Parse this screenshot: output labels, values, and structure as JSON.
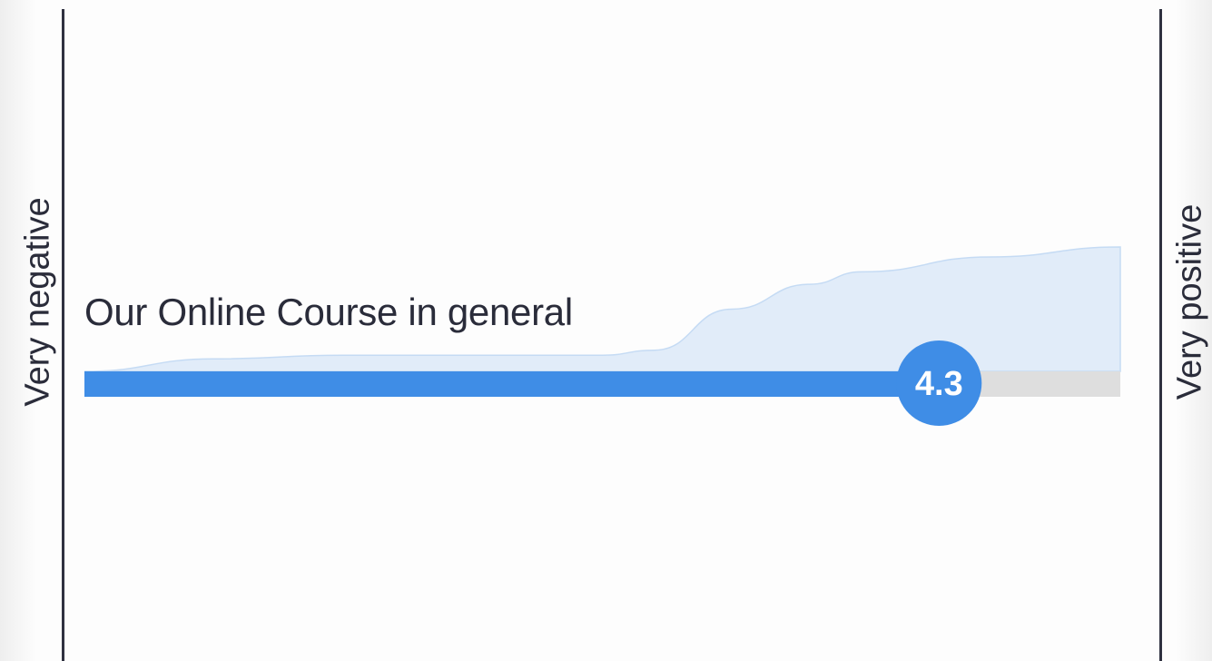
{
  "chart_data": {
    "type": "area",
    "title": "",
    "item_label": "Our Online Course in general",
    "scale_min_label": "Very negative",
    "scale_max_label": "Very positive",
    "score": 4.3,
    "score_label": "4.3",
    "scale_range": [
      1,
      5
    ],
    "distribution": {
      "x": [
        1.0,
        1.5,
        2.0,
        2.5,
        3.0,
        3.2,
        3.5,
        3.8,
        4.0,
        4.5,
        5.0
      ],
      "density": [
        0.0,
        0.1,
        0.13,
        0.13,
        0.13,
        0.17,
        0.5,
        0.7,
        0.8,
        0.92,
        1.0
      ]
    },
    "colors": {
      "bar_fill": "#3f8de6",
      "bar_track": "#dedede",
      "distribution_fill": "#e1ecf9",
      "distribution_stroke": "#c5dbf4",
      "badge_fill": "#3f8de6",
      "badge_text": "#ffffff",
      "axis_line": "#2f3140",
      "text": "#2a2c3a"
    }
  }
}
